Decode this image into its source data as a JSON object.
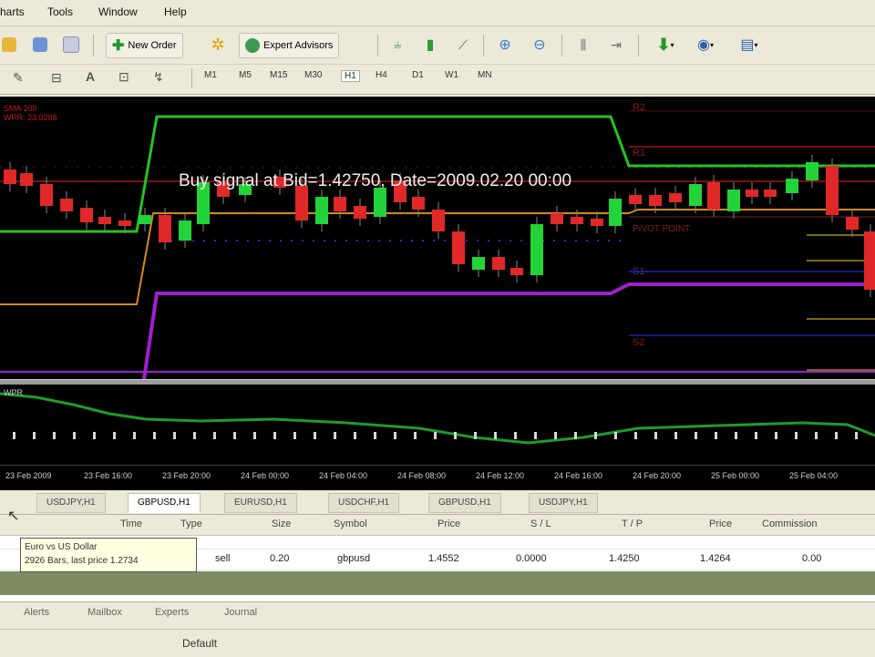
{
  "menu": {
    "items": [
      "harts",
      "Tools",
      "Window",
      "Help"
    ]
  },
  "toolbar": {
    "new_order_label": "New Order",
    "expert_advisors_label": "Expert Advisors",
    "timeframes": [
      "M1",
      "M5",
      "M15",
      "M30",
      "H1",
      "H4",
      "D1",
      "W1",
      "MN"
    ]
  },
  "chart": {
    "overlay_text": "Buy signal at Bid=1.42750, Date=2009.02.20 00:00",
    "levels": {
      "r2": "R2",
      "r1": "R1",
      "pivot": "PIVOT POINT",
      "s1": "S1",
      "s2": "S2"
    },
    "price_labels": [
      "SMA 200",
      "WPR: 23.0208"
    ],
    "colors": {
      "green_line": "#22c422",
      "orange_line": "#d48a1a",
      "purple_line": "#a020d0",
      "red_level": "#c41c1c",
      "blue_dots": "#2a2ad8",
      "bull": "#22d43a",
      "bear": "#e02828"
    }
  },
  "oscillator": {
    "label": "WPR"
  },
  "time_axis": {
    "labels": [
      "23 Feb 2009",
      "23 Feb 16:00",
      "23 Feb 20:00",
      "24 Feb 00:00",
      "24 Feb 04:00",
      "24 Feb 08:00",
      "24 Feb 12:00",
      "24 Feb 16:00",
      "24 Feb 20:00",
      "25 Feb 00:00",
      "25 Feb 04:00"
    ]
  },
  "chart_tabs": [
    "USDJPY,H1",
    "GBPUSD,H1",
    "EURUSD,H1",
    "USDCHF,H1",
    "GBPUSD,H1",
    "USDJPY,H1"
  ],
  "chart_tabs_active": 1,
  "terminal": {
    "columns": [
      "Time",
      "Type",
      "Size",
      "Symbol",
      "Price",
      "S / L",
      "T / P",
      "Price",
      "Commission"
    ],
    "row": {
      "type": "sell",
      "size": "0.20",
      "symbol": "gbpusd",
      "price": "1.4552",
      "sl": "0.0000",
      "tp": "1.4250",
      "price_now": "1.4264",
      "commission": "0.00"
    },
    "tooltip_line1": "Euro vs US Dollar",
    "tooltip_line2": "2926 Bars, last price 1.2734"
  },
  "bottom_tabs": [
    "Alerts",
    "Mailbox",
    "Experts",
    "Journal"
  ],
  "status": {
    "profile": "Default"
  }
}
